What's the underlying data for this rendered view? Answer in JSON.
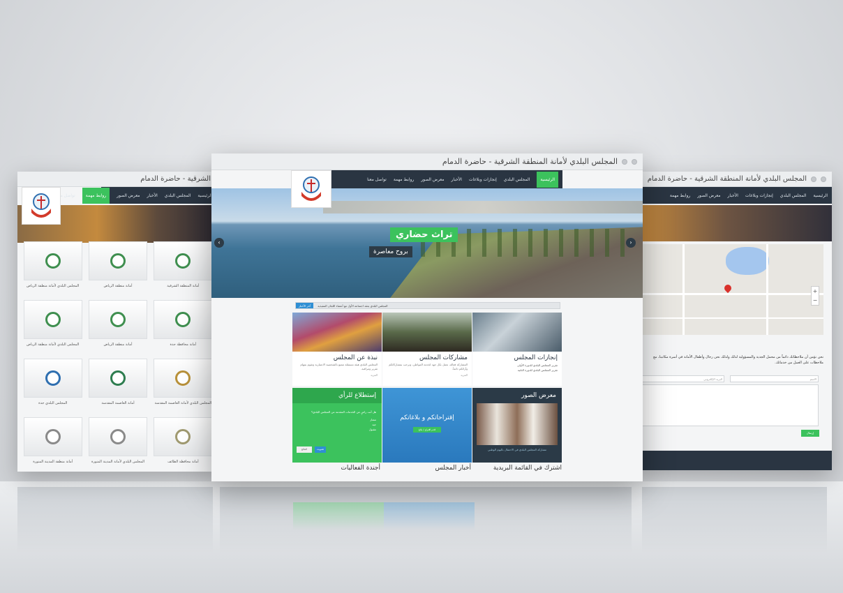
{
  "left_window": {
    "title": "الشرقية - حاضرة الدمام",
    "nav": [
      "الرئيسية",
      "المجلس البلدي",
      "الأخبار",
      "معرض الصور",
      "روابط مهمة",
      "تواصل معنا"
    ],
    "tiles": [
      "أمانة المنطقة الشرقية",
      "أمانة منطقة الرياض",
      "المجلس البلدي لأمانة منطقة الرياض",
      "أمانة محافظة جدة",
      "أمانة منطقة الرياض",
      "المجلس البلدي لأمانة منطقة الرياض",
      "المجلس البلدي لأمانة العاصمة المقدسة",
      "أمانة العاصمة المقدسة",
      "المجلس البلدي جدة",
      "أمانة محافظة الطائف",
      "المجلس البلدي لأمانة المدينة المنورة",
      "أمانة منطقة المدينة المنورة"
    ]
  },
  "right_window": {
    "title": "المجلس البلدي لأمانة المنطقة الشرقية - حاضرة الدمام",
    "nav": [
      "الرئيسية",
      "المجلس البلدي",
      "إنجازات وبلاغات",
      "الأخبار",
      "معرض الصور",
      "روابط مهمة"
    ],
    "contact_text": "نحن نؤمن أن ملاحظاتك دائماً من محمل الجدية والمسؤولية لذلك ولذلك نحن رجال وأطفال الأمانة في أسرة مكاتبنا، مع ملاحظات على العمل من خدماتك.",
    "name_placeholder": "الاسم",
    "email_placeholder": "البريد الإلكتروني",
    "send_label": "إرسال"
  },
  "center_window": {
    "title": "المجلس البلدي لأمانة المنطقة الشرقية - حاضرة الدمام",
    "nav": [
      "الرئيسية",
      "المجلس البلدي",
      "إنجازات وبلاغات",
      "الأخبار",
      "معرض الصور",
      "روابط مهمة",
      "تواصل معنا"
    ],
    "slide_title": "تراث حضاري",
    "slide_subtitle": "بروح معاصرة",
    "ticker_label": "آخر الأخبار",
    "ticker_text": "المجلس البلدي يعقد اجتماعه الأول مع أعضاء اللجان التنفيذية",
    "cards": [
      {
        "title": "إنجازات المجلس",
        "items": [
          "تقرير المجلس البلدي للدورة الأولى",
          "تقرير المجلس البلدي للدورة الثانية"
        ]
      },
      {
        "title": "مشاركات المجلس",
        "text": "المشاركة فعالة، نعمل بكل جهد لخدمة المواطن، ونرحب بمشاركاتكم وآرائكم دائماً.",
        "more": "المزيد"
      },
      {
        "title": "نبذة عن المجلس",
        "text": "المجلس البلدي هيئة مستقلة تتمتع بالشخصية الاعتبارية وتقوم بمهام تقرير ومراقبة.",
        "more": "المزيد"
      }
    ],
    "gallery_title": "معرض الصور",
    "gallery_caption": "مشاركة المجلس البلدي في الاحتفال باليوم الوطني",
    "suggest_title": "إقتراحاتكم و بلاغاتكم",
    "suggest_button": "قدم اقتراح / بلاغ",
    "poll_title": "إستطلاع للرأي",
    "poll_question": "هل أنت راضٍ عن الخدمات المقدمة من المجلس البلدي؟",
    "poll_options": [
      "ممتاز",
      "جيد",
      "مقبول"
    ],
    "poll_vote": "تصويت",
    "poll_results": "النتائج",
    "bottom_titles": [
      "اشترك في القائمة البريدية",
      "أخبار المجلس",
      "أجندة الفعاليات"
    ]
  }
}
